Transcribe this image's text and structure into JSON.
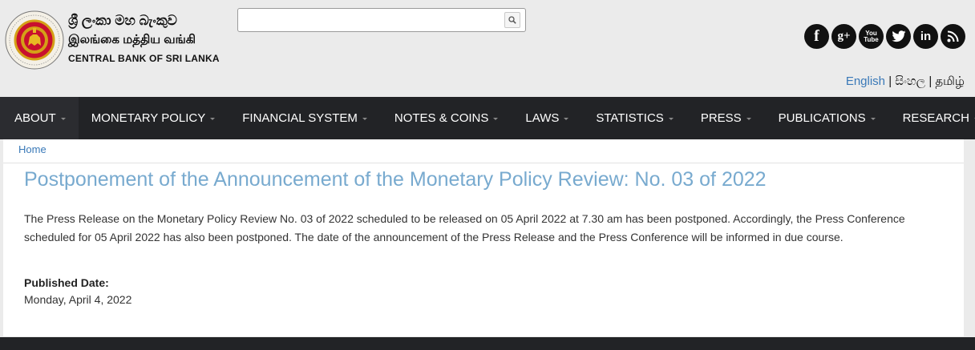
{
  "header": {
    "brand": {
      "name_sinhala": "ශ්‍රී ලංකා මහ බැංකුව",
      "name_tamil": "இலங்கை மத்திய வங்கி",
      "name_english": "CENTRAL BANK OF SRI LANKA"
    },
    "search": {
      "value": "",
      "placeholder": ""
    },
    "social": [
      {
        "name": "facebook",
        "glyph": "f"
      },
      {
        "name": "google-plus",
        "glyph": "g+"
      },
      {
        "name": "youtube",
        "glyph": "You Tube"
      },
      {
        "name": "twitter",
        "glyph": ""
      },
      {
        "name": "linkedin",
        "glyph": "in"
      },
      {
        "name": "rss",
        "glyph": ""
      }
    ],
    "languages": [
      "English",
      "සිංහල",
      "தமிழ்"
    ],
    "language_separator": "|"
  },
  "nav": {
    "items": [
      {
        "label": "ABOUT"
      },
      {
        "label": "MONETARY POLICY"
      },
      {
        "label": "FINANCIAL SYSTEM"
      },
      {
        "label": "NOTES & COINS"
      },
      {
        "label": "LAWS"
      },
      {
        "label": "STATISTICS"
      },
      {
        "label": "PRESS"
      },
      {
        "label": "PUBLICATIONS"
      },
      {
        "label": "RESEARCH"
      }
    ]
  },
  "breadcrumb": {
    "home": "Home"
  },
  "article": {
    "title": "Postponement of the Announcement of the Monetary Policy Review: No. 03 of 2022",
    "body": "The Press Release on the Monetary Policy Review No. 03 of 2022 scheduled to be released on 05 April 2022 at 7.30 am has been postponed. Accordingly, the Press Conference scheduled for 05 April 2022 has also been postponed. The date of the announcement of the Press Release and the Press Conference will be informed in due course.",
    "published_label": "Published Date:",
    "published_date": "Monday, April 4, 2022"
  },
  "colors": {
    "nav_bg": "#222326",
    "title": "#78aacf",
    "link": "#3a79b8",
    "header_bg": "#ebebeb"
  }
}
